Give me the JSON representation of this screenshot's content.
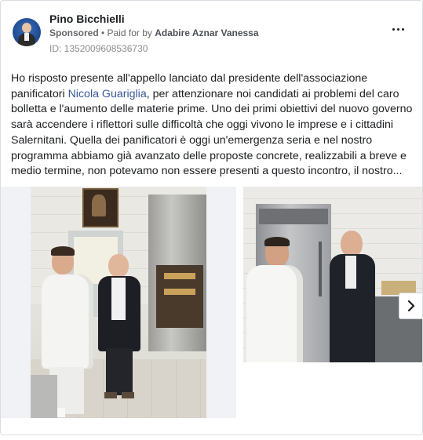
{
  "post": {
    "author": "Pino Bicchielli",
    "sponsored_label": "Sponsored",
    "separator": " • ",
    "paid_prefix": "Paid for by ",
    "paid_by": "Adabire Aznar Vanessa",
    "id_line": "ID: 1352009608536730",
    "text_before_link": "Ho risposto presente all'appello lanciato dal presidente dell'associazione panificatori ",
    "link_text": "Nicola Guariglia",
    "text_after_link": ", per attenzionare noi candidati ai problemi del caro bolletta e l'aumento delle materie prime. Uno dei primi obiettivi del nuovo governo sarà accendere i riflettori sulle difficoltà che oggi vivono le imprese e i cittadini Salernitani. Quella dei panificatori è oggi un'emergenza seria e nel nostro programma abbiamo già avanzato delle proposte concrete, realizzabili a breve e medio termine, non potevamo non essere presenti a questo incontro, il nostro..."
  },
  "icons": {
    "more": "more-options-icon",
    "next": "chevron-right-icon",
    "avatar": "profile-avatar"
  }
}
